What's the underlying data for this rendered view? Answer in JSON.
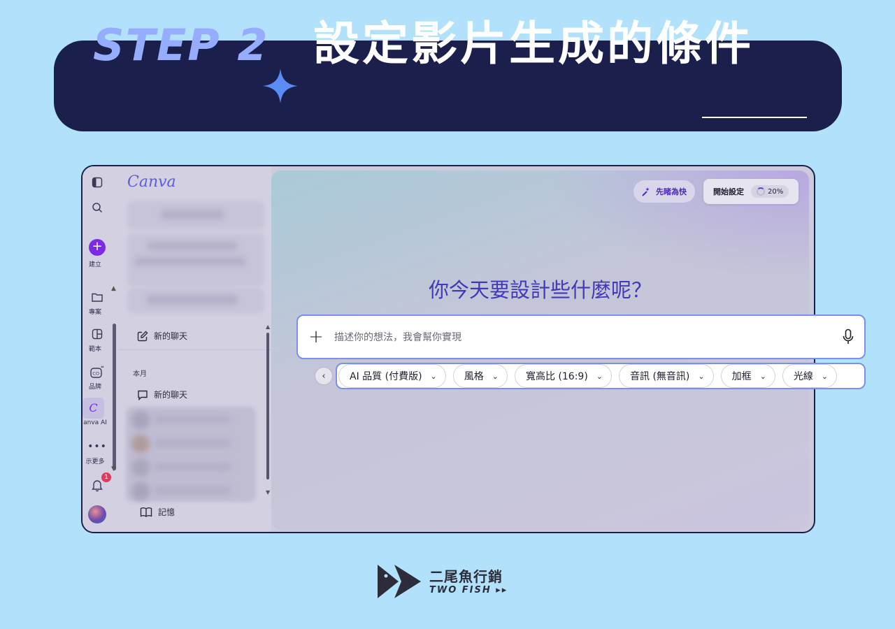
{
  "banner": {
    "step": "STEP 2",
    "title": "設定影片生成的條件"
  },
  "rail": {
    "create_label": "建立",
    "projects_label": "專案",
    "templates_label": "範本",
    "brand_label": "品牌",
    "canva_ai_label": "anva AI",
    "more_label": "示更多",
    "notification_count": "1"
  },
  "sidebar": {
    "logo": "Canva",
    "new_chat_top": "新的聊天",
    "month_header": "本月",
    "new_chat_item": "新的聊天",
    "memory": "記憶"
  },
  "main": {
    "quick_label": "先睹為快",
    "setup_label": "開始設定",
    "setup_progress": "20%",
    "headline": "你今天要設計些什麼呢？",
    "prompt_placeholder": "描述你的想法，我會幫你實現",
    "chips": [
      {
        "label": "AI 品質 (付費版)"
      },
      {
        "label": "風格"
      },
      {
        "label": "寬高比 (16:9)"
      },
      {
        "label": "音訊 (無音訊)"
      },
      {
        "label": "加框"
      },
      {
        "label": "光線"
      }
    ]
  },
  "footer": {
    "brand_name": "二尾魚行銷",
    "brand_sub": "TWO FISH ▸▸"
  },
  "colors": {
    "page_bg": "#b2e2fb",
    "banner_bg": "#1a1f4b",
    "step_color": "#96acff",
    "accent": "#7d2ae8",
    "headline": "#4338b8",
    "highlight_border": "#7a8ff0"
  }
}
